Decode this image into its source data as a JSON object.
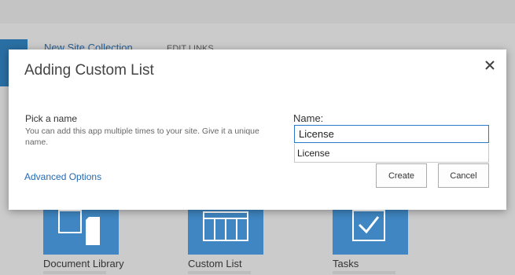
{
  "background": {
    "nav": {
      "new_site_collection": "New Site Collection",
      "edit_links": "EDIT LINKS"
    },
    "apps": [
      {
        "name": "Document Library",
        "icon": "document-library-icon"
      },
      {
        "name": "Custom List",
        "icon": "custom-list-icon"
      },
      {
        "name": "Tasks",
        "icon": "tasks-icon"
      }
    ]
  },
  "dialog": {
    "title": "Adding Custom List",
    "close_icon": "close-icon",
    "field": {
      "title": "Pick a name",
      "description": "You can add this app multiple times to your site. Give it a unique name."
    },
    "name_label": "Name:",
    "name_value": "License",
    "suggestion": "License",
    "advanced_options": "Advanced Options",
    "create_label": "Create",
    "cancel_label": "Cancel"
  },
  "colors": {
    "accent": "#2a7acb",
    "tile": "#3f86c2",
    "link": "#2469b3"
  }
}
